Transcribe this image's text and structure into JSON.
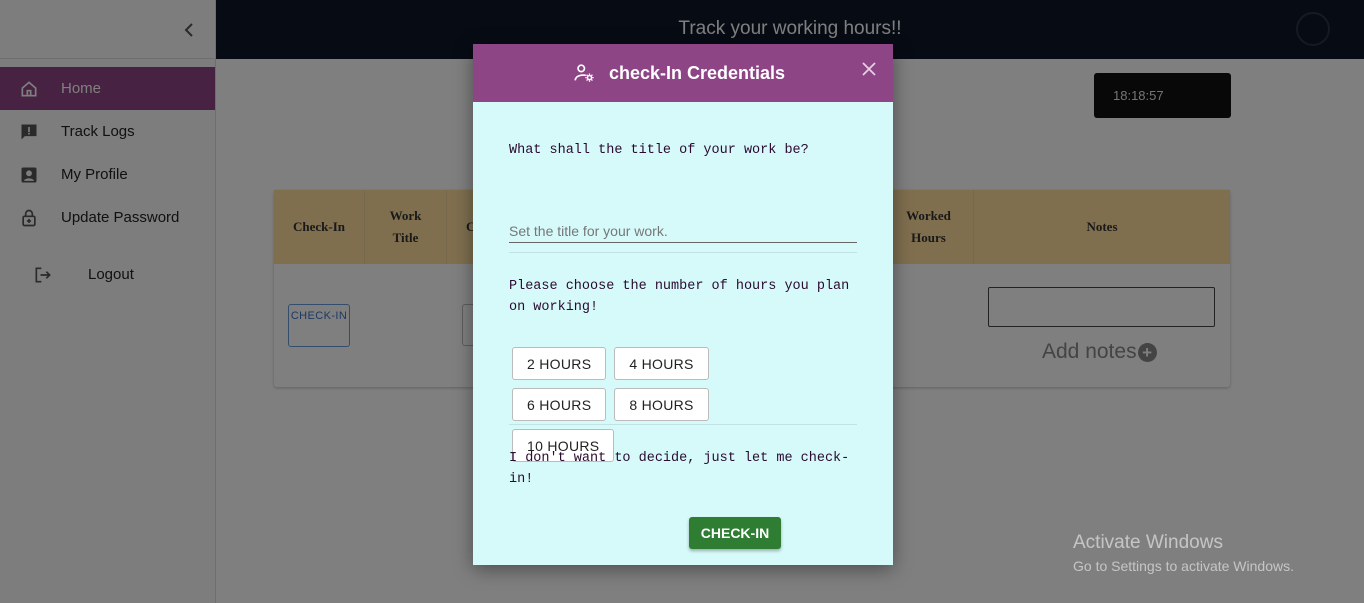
{
  "header": {
    "title": "Track your working hours!!"
  },
  "sidebar": {
    "items": [
      {
        "label": "Home",
        "icon": "home-icon",
        "active": true
      },
      {
        "label": "Track Logs",
        "icon": "feedback-icon"
      },
      {
        "label": "My Profile",
        "icon": "account-box-icon"
      },
      {
        "label": "Update Password",
        "icon": "lock-icon"
      }
    ],
    "logout_label": "Logout"
  },
  "clock": {
    "time": "18:18:57"
  },
  "table": {
    "headers": [
      "Check-In",
      "Work Title",
      "C",
      "Worked Hours",
      "Notes"
    ],
    "checkin_button": "CHECK-IN",
    "add_notes": "Add notes"
  },
  "modal": {
    "title": "check-In Credentials",
    "question_title": "What shall the title of your work be?",
    "title_placeholder": "Set the title for your work.",
    "question_hours": "Please choose the number of hours you plan on working!",
    "hour_options": [
      "2 HOURS",
      "4 HOURS",
      "6 HOURS",
      "8 HOURS",
      "10 HOURS"
    ],
    "question_skip": "I don't want to decide, just let me check-in!",
    "checkin_label": "CHECK-IN"
  },
  "watermark": {
    "line1": "Activate Windows",
    "line2": "Go to Settings to activate Windows."
  },
  "colors": {
    "brand": "#8e4585",
    "header": "#0e1729",
    "modal_bg": "#d6fafa",
    "table_header": "#ffdf9e",
    "checkin": "#2e7d32"
  }
}
